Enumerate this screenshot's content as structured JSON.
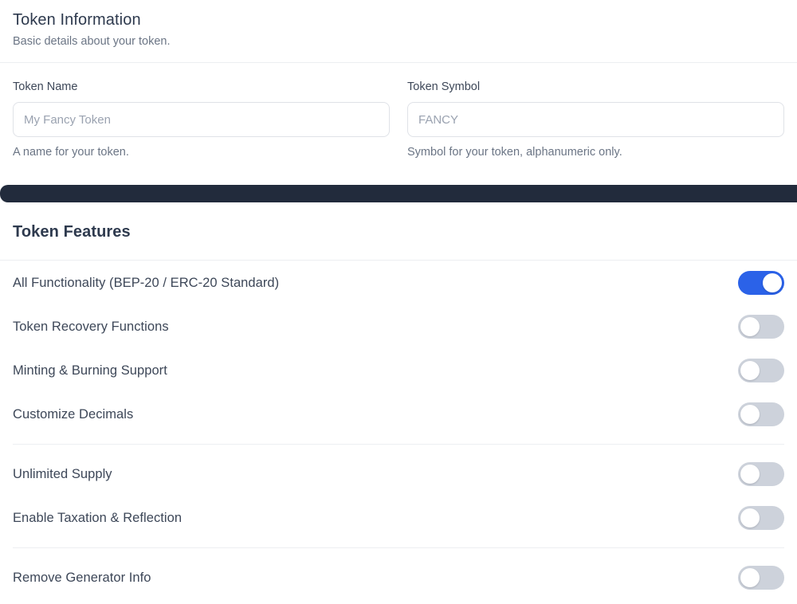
{
  "token_information": {
    "title": "Token Information",
    "subtitle": "Basic details about your token.",
    "fields": [
      {
        "label": "Token Name",
        "value": "",
        "placeholder": "My Fancy Token",
        "help": "A name for your token."
      },
      {
        "label": "Token Symbol",
        "value": "",
        "placeholder": "FANCY",
        "help": "Symbol for your token, alphanumeric only."
      }
    ]
  },
  "token_features": {
    "title": "Token Features",
    "groups": [
      {
        "items": [
          {
            "label": "All Functionality (BEP-20 / ERC-20 Standard)",
            "enabled": true
          },
          {
            "label": "Token Recovery Functions",
            "enabled": false
          },
          {
            "label": "Minting & Burning Support",
            "enabled": false
          },
          {
            "label": "Customize Decimals",
            "enabled": false
          }
        ]
      },
      {
        "items": [
          {
            "label": "Unlimited Supply",
            "enabled": false
          },
          {
            "label": "Enable Taxation & Reflection",
            "enabled": false
          }
        ]
      },
      {
        "items": [
          {
            "label": "Remove Generator Info",
            "enabled": false
          }
        ]
      }
    ]
  },
  "colors": {
    "accent": "#2b62e8",
    "toggle_off": "#cdd2db",
    "dark_band": "#222b3c",
    "heading_text": "#2e3a4e",
    "body_text": "#3d4758",
    "muted_text": "#6b7585",
    "border": "#dfe2e7",
    "divider": "#edeff2"
  }
}
